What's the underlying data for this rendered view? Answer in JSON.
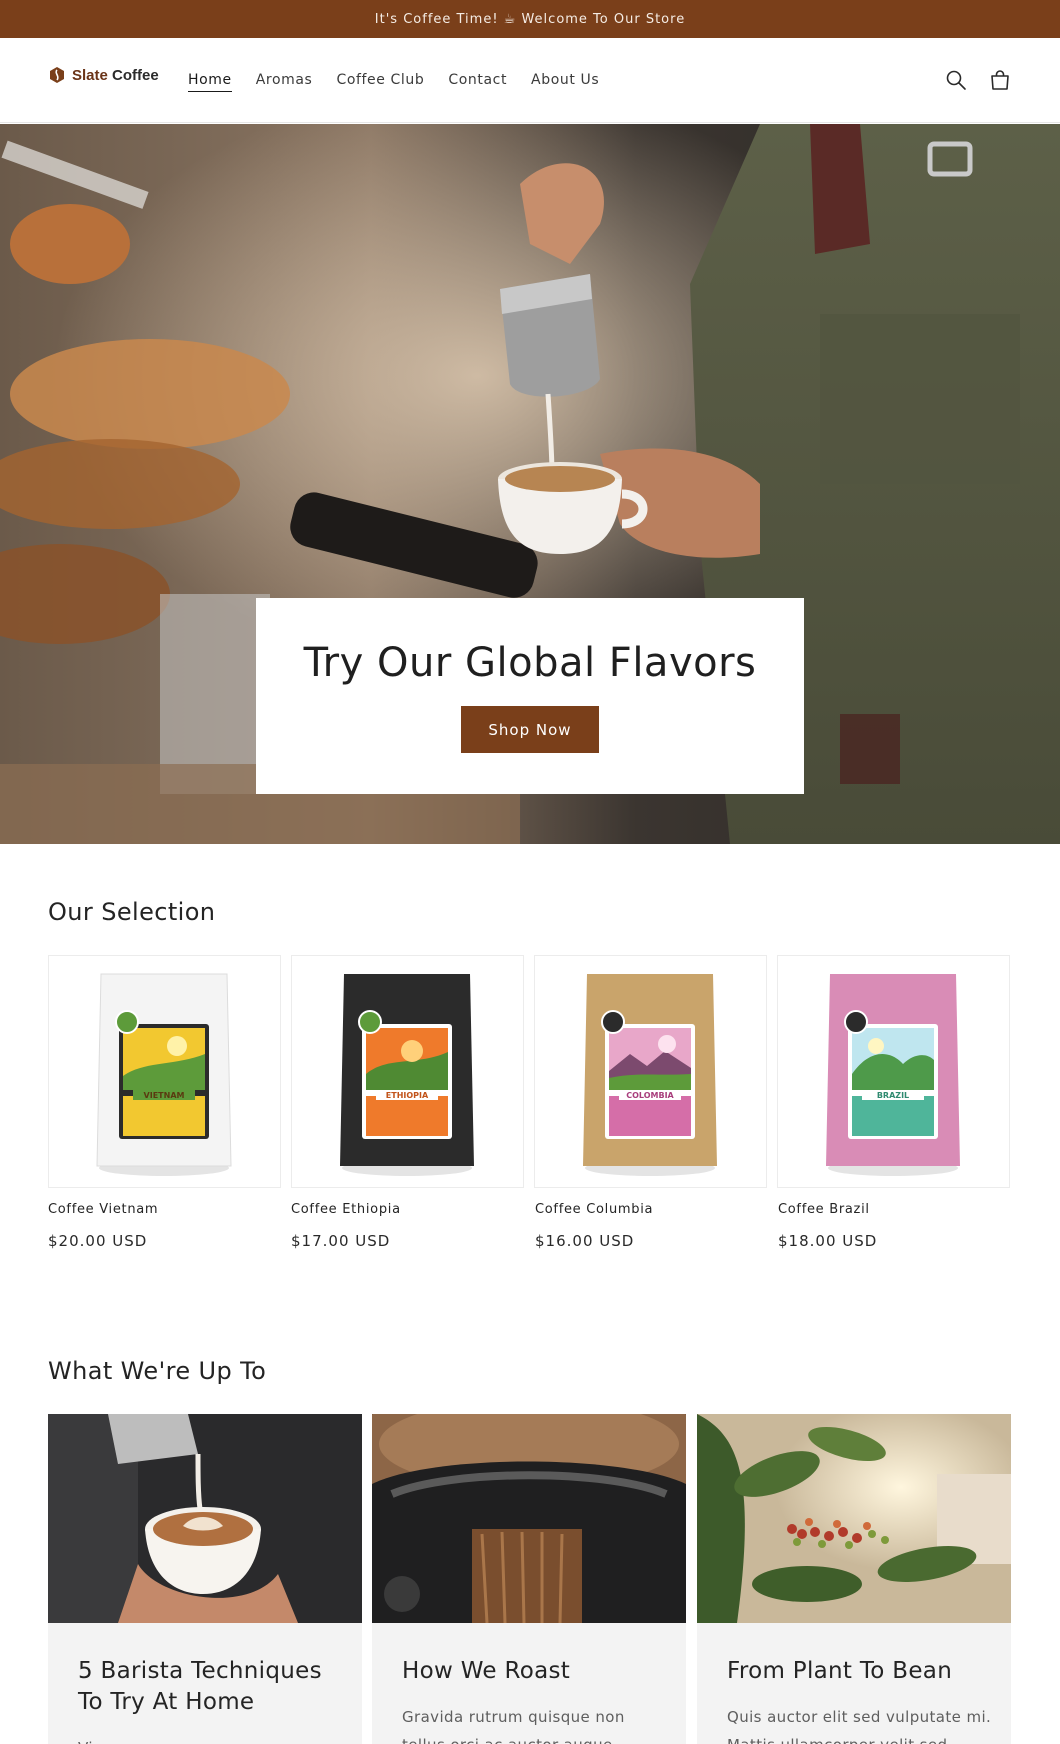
{
  "announcement": {
    "text": "It's Coffee Time! ☕ Welcome To Our Store"
  },
  "brand": {
    "name_first": "Slate",
    "name_second": "Coffee"
  },
  "nav": {
    "items": [
      {
        "label": "Home",
        "active": true
      },
      {
        "label": "Aromas",
        "active": false
      },
      {
        "label": "Coffee Club",
        "active": false
      },
      {
        "label": "Contact",
        "active": false
      },
      {
        "label": "About Us",
        "active": false
      }
    ]
  },
  "header_icons": [
    "search-icon",
    "cart-icon"
  ],
  "hero": {
    "title": "Try Our Global Flavors",
    "button_label": "Shop Now"
  },
  "selection": {
    "title": "Our Selection",
    "products": [
      {
        "name": "Coffee Vietnam",
        "price": "$20.00 USD",
        "label": "VIETNAM",
        "bag_color": "#f4f4f4",
        "accent": "#f2c830"
      },
      {
        "name": "Coffee Ethiopia",
        "price": "$17.00 USD",
        "label": "ETHIOPIA",
        "bag_color": "#2b2b2b",
        "accent": "#ef7a2b"
      },
      {
        "name": "Coffee Columbia",
        "price": "$16.00 USD",
        "label": "COLOMBIA",
        "bag_color": "#c9a46b",
        "accent": "#d56ea8"
      },
      {
        "name": "Coffee Brazil",
        "price": "$18.00 USD",
        "label": "BRAZIL",
        "bag_color": "#d98cb6",
        "accent": "#4fb59a"
      }
    ]
  },
  "blog": {
    "title": "What We're Up To",
    "posts": [
      {
        "title": "5 Barista Techniques To Try At Home",
        "excerpt": "Viverra maecenas accumsan"
      },
      {
        "title": "How We Roast",
        "excerpt": "Gravida rutrum quisque non tellus orci ac auctor augue"
      },
      {
        "title": "From Plant To Bean",
        "excerpt": "Quis auctor elit sed vulputate mi. Mattis ullamcorper velit sed"
      }
    ]
  },
  "colors": {
    "brand_brown": "#7a3f1a",
    "text_dark": "#1f1f1f"
  }
}
